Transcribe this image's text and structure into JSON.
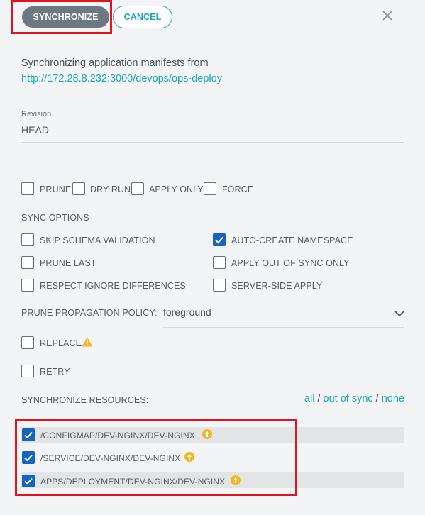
{
  "toolbar": {
    "synchronize_label": "SYNCHRONIZE",
    "cancel_label": "CANCEL"
  },
  "sync_source": {
    "intro": "Synchronizing application manifests from",
    "repo_url": "http://172.28.8.232:3000/devops/ops-deploy"
  },
  "revision": {
    "label": "Revision",
    "value": "HEAD"
  },
  "options": [
    {
      "label": "PRUNE",
      "checked": false
    },
    {
      "label": "DRY RUN",
      "checked": false
    },
    {
      "label": "APPLY ONLY",
      "checked": false
    },
    {
      "label": "FORCE",
      "checked": false
    }
  ],
  "sync_options": {
    "heading": "SYNC OPTIONS",
    "left": [
      {
        "label": "SKIP SCHEMA VALIDATION",
        "checked": false
      },
      {
        "label": "PRUNE LAST",
        "checked": false
      },
      {
        "label": "RESPECT IGNORE DIFFERENCES",
        "checked": false
      }
    ],
    "right": [
      {
        "label": "AUTO-CREATE NAMESPACE",
        "checked": true
      },
      {
        "label": "APPLY OUT OF SYNC ONLY",
        "checked": false
      },
      {
        "label": "SERVER-SIDE APPLY",
        "checked": false
      }
    ]
  },
  "prune_policy": {
    "label": "PRUNE PROPAGATION POLICY:",
    "value": "foreground"
  },
  "replace": {
    "label": "REPLACE",
    "checked": false,
    "icon": "warning-icon"
  },
  "retry": {
    "label": "RETRY",
    "checked": false
  },
  "resources": {
    "heading": "SYNCHRONIZE RESOURCES:",
    "filter_all": "all",
    "sep1": "/",
    "filter_out_of_sync": "out of sync",
    "sep2": "/",
    "filter_none": "none",
    "items": [
      {
        "label": "/CONFIGMAP/DEV-NGINX/DEV-NGINX",
        "checked": true,
        "status_icon": "out-of-sync-icon"
      },
      {
        "label": "/SERVICE/DEV-NGINX/DEV-NGINX",
        "checked": true,
        "status_icon": "out-of-sync-icon"
      },
      {
        "label": "APPS/DEPLOYMENT/DEV-NGINX/DEV-NGINX",
        "checked": true,
        "status_icon": "out-of-sync-icon"
      }
    ]
  },
  "colors": {
    "accent": "#19a7b8",
    "checkbox_checked": "#1565c0",
    "highlight": "#e0161f",
    "status_warning": "#f5b623",
    "primary_button": "#6c7882"
  }
}
